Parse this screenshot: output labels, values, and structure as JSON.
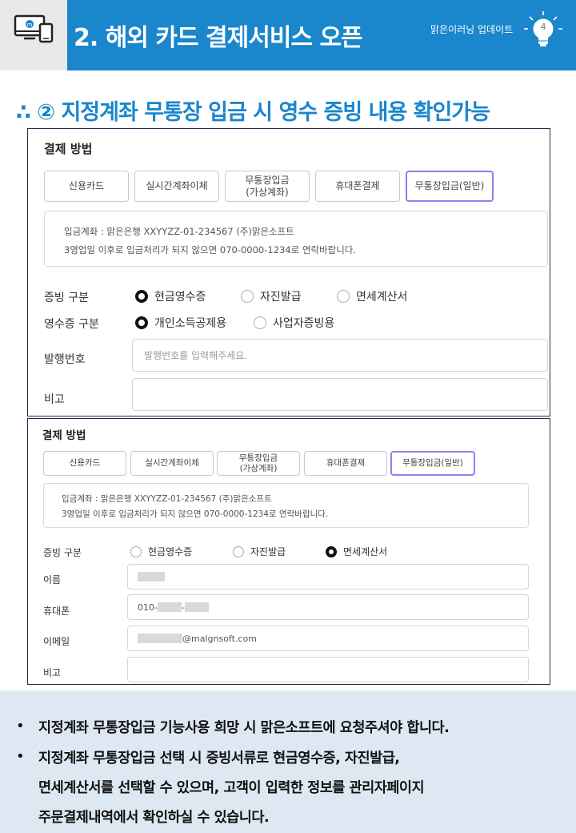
{
  "header": {
    "title": "2. 해외 카드 결제서비스 오픈",
    "subtitle": "맑은이러닝 업데이트",
    "page_number": "4"
  },
  "section_title": "∴ ② 지정계좌 무통장 입금 시 영수 증빙 내용 확인가능",
  "panel1": {
    "title": "결제 방법",
    "tabs": [
      "신용카드",
      "실시간계좌이체",
      "무통장입금\n(가상계좌)",
      "휴대폰결제",
      "무통장입금(일반)"
    ],
    "info_line1": "입금계좌 : 맑은은행 XXYYZZ-01-234567 (주)맑은소프트",
    "info_line2": "3영업일 이후로 입금처리가 되지 않으면 070-0000-1234로 연락바랍니다.",
    "receipt_label": "증빙 구분",
    "receipt_options": [
      "현금영수증",
      "자진발급",
      "면세계산서"
    ],
    "cash_label": "영수증 구분",
    "cash_options": [
      "개인소득공제용",
      "사업자증빙용"
    ],
    "issue_label": "발행번호",
    "issue_placeholder": "발행번호를 입력해주세요.",
    "note_label": "비고"
  },
  "panel2": {
    "title": "결제 방법",
    "tabs": [
      "신용카드",
      "실시간계좌이체",
      "무통장입금\n(가상계좌)",
      "휴대폰결제",
      "무통장입금(일반)"
    ],
    "info_line1": "입금계좌 : 맑은은행 XXYYZZ-01-234567 (주)맑은소프트",
    "info_line2": "3영업일 이후로 입금처리가 되지 않으면 070-0000-1234로 연락바랍니다.",
    "receipt_label": "증빙 구분",
    "receipt_options": [
      "현금영수증",
      "자진발급",
      "면세계산서"
    ],
    "name_label": "이름",
    "phone_label": "휴대폰",
    "phone_prefix": "010-",
    "phone_sep": "-",
    "email_label": "이메일",
    "email_domain": "@malgnsoft.com",
    "note_label": "비고"
  },
  "notes": {
    "line1": "지정계좌 무통장입금 기능사용 희망 시 맑은소프트에 요청주셔야 합니다.",
    "line2": "지정계좌 무통장입금 선택 시 증빙서류로 현금영수증, 자진발급,",
    "line3": "면세계산서를 선택할 수 있으며, 고객이 입력한 정보를 관리자페이지",
    "line4": "주문결제내역에서 확인하실 수 있습니다.",
    "bullet": "•"
  },
  "colors": {
    "accent": "#1a86cc",
    "selected_tab_border": "#8e7ef0",
    "notes_bg": "#dde8f2"
  }
}
